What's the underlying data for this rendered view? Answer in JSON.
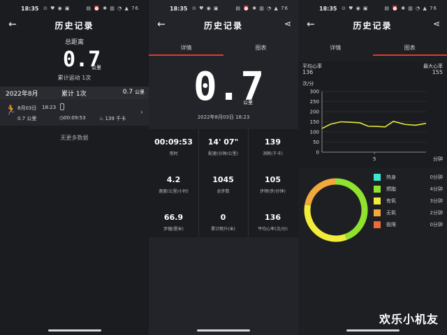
{
  "status_bar": {
    "time": "18:35",
    "battery": "76"
  },
  "screen1": {
    "title": "历史记录",
    "total_label": "总距离",
    "total_value": "0.7",
    "total_unit": "公里",
    "count_text": "累计运动 1次",
    "month": "2022年8月",
    "month_count": "累计 1次",
    "month_distance": "0.7",
    "month_unit": "公里",
    "record": {
      "date": "8月03日",
      "time": "18:23",
      "distance": "0.7 公里",
      "duration": "00:09:53",
      "calories": "139 千卡"
    },
    "no_more": "无更多数据"
  },
  "screen2": {
    "title": "历史记录",
    "tabs": [
      "详情",
      "图表"
    ],
    "active_tab": 0,
    "distance_value": "0.7",
    "distance_unit": "公里",
    "date": "2022年8月03日 18:23",
    "stats": [
      {
        "value": "00:09:53",
        "label": "用时"
      },
      {
        "value": "14' 07\"",
        "label": "配速(分钟/公里)"
      },
      {
        "value": "139",
        "label": "消耗(千卡)"
      },
      {
        "value": "4.2",
        "label": "速度(公里/小时)"
      },
      {
        "value": "1045",
        "label": "总步数"
      },
      {
        "value": "105",
        "label": "步频(步/分钟)"
      },
      {
        "value": "66.9",
        "label": "步幅(厘米)"
      },
      {
        "value": "0",
        "label": "累计爬升(米)"
      },
      {
        "value": "136",
        "label": "平均心率(次/分)"
      }
    ]
  },
  "screen3": {
    "title": "历史记录",
    "tabs": [
      "详情",
      "图表"
    ],
    "active_tab": 1,
    "avg_hr_label": "平均心率",
    "avg_hr": "136",
    "max_hr_label": "最大心率",
    "max_hr": "155",
    "zones": [
      {
        "name": "热身",
        "value": "0分钟",
        "color": "#3ee6d0"
      },
      {
        "name": "燃脂",
        "value": "4分钟",
        "color": "#8fe32f"
      },
      {
        "name": "有氧",
        "value": "3分钟",
        "color": "#f2ec3a"
      },
      {
        "name": "无氧",
        "value": "2分钟",
        "color": "#f0a93a"
      },
      {
        "name": "极限",
        "value": "0分钟",
        "color": "#ef6a3a"
      }
    ]
  },
  "chart_data": {
    "type": "line",
    "title": "",
    "ylabel": "次/分",
    "xlabel": "分钟",
    "ylim": [
      0,
      300
    ],
    "yticks": [
      0,
      50,
      100,
      150,
      200,
      250,
      300
    ],
    "xticks": [
      5
    ],
    "xlim": [
      0,
      9.9
    ],
    "x": [
      0,
      0.8,
      1.8,
      2.6,
      3.6,
      4.4,
      5.3,
      6.0,
      6.8,
      7.9,
      8.9,
      9.9
    ],
    "series": [
      {
        "name": "",
        "values": [
          117,
          138,
          150,
          148,
          145,
          128,
          127,
          125,
          152,
          137,
          133,
          142
        ]
      }
    ],
    "donut": [
      {
        "name": "燃脂",
        "value": 4
      },
      {
        "name": "有氧",
        "value": 3
      },
      {
        "name": "无氧",
        "value": 2
      }
    ]
  },
  "watermark": "欢乐小机友"
}
